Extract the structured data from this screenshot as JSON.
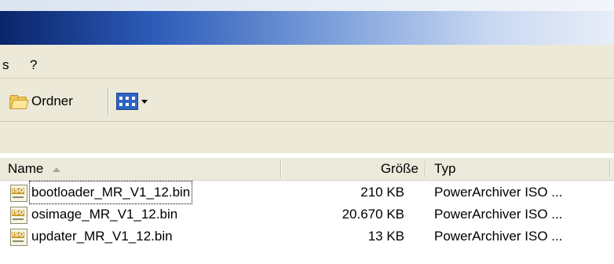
{
  "menu": {
    "item_s": "s",
    "item_help": "?"
  },
  "toolbar": {
    "folders_label": "Ordner"
  },
  "columns": {
    "name": "Name",
    "size": "Größe",
    "type": "Typ"
  },
  "files": [
    {
      "name": "bootloader_MR_V1_12.bin",
      "size": "210 KB",
      "type": "PowerArchiver ISO ..."
    },
    {
      "name": "osimage_MR_V1_12.bin",
      "size": "20.670 KB",
      "type": "PowerArchiver ISO ..."
    },
    {
      "name": "updater_MR_V1_12.bin",
      "size": "13 KB",
      "type": "PowerArchiver ISO ..."
    }
  ],
  "icons": {
    "file": "iso-file-icon",
    "iso_band_text": "ISO"
  }
}
